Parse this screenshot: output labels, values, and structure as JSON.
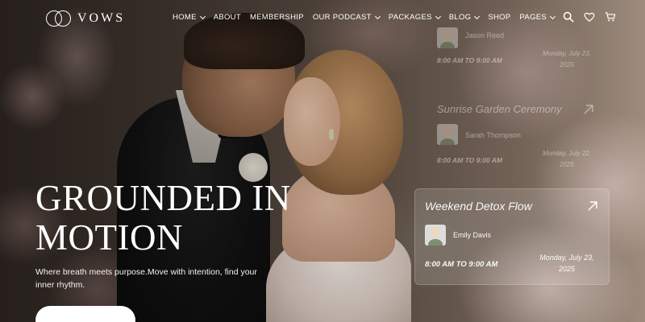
{
  "brand": {
    "name": "VOWS"
  },
  "nav": {
    "items": [
      {
        "label": "HOME",
        "dropdown": true
      },
      {
        "label": "ABOUT",
        "dropdown": false
      },
      {
        "label": "MEMBERSHIP",
        "dropdown": false
      },
      {
        "label": "OUR PODCAST",
        "dropdown": true
      },
      {
        "label": "PACKAGES",
        "dropdown": true
      },
      {
        "label": "BLOG",
        "dropdown": true
      },
      {
        "label": "SHOP",
        "dropdown": false
      },
      {
        "label": "PAGES",
        "dropdown": true
      }
    ],
    "icons": [
      "search-icon",
      "heart-icon",
      "cart-icon"
    ]
  },
  "hero": {
    "title": "GROUNDED IN MOTION",
    "subtitle": "Where breath meets purpose.Move with intention, find your inner rhythm."
  },
  "events": [
    {
      "title": "",
      "host": "Jason Reed",
      "time": "8:00 AM TO 9:00 AM",
      "date_line1": "Monday, July 23,",
      "date_line2": "2025",
      "state": "faded"
    },
    {
      "title": "Sunrise Garden Ceremony",
      "host": "Sarah Thompson",
      "time": "8:00 AM TO 9:00 AM",
      "date_line1": "Monday, July 22,",
      "date_line2": "2025",
      "state": "faded"
    },
    {
      "title": "Weekend Detox Flow",
      "host": "Emily Davis",
      "time": "8:00 AM TO 9:00 AM",
      "date_line1": "Monday, July 23,",
      "date_line2": "2025",
      "state": "active"
    }
  ],
  "colors": {
    "text": "#ffffff",
    "button_bg": "#ffffff",
    "card_bg": "rgba(255,255,255,0.14)"
  }
}
